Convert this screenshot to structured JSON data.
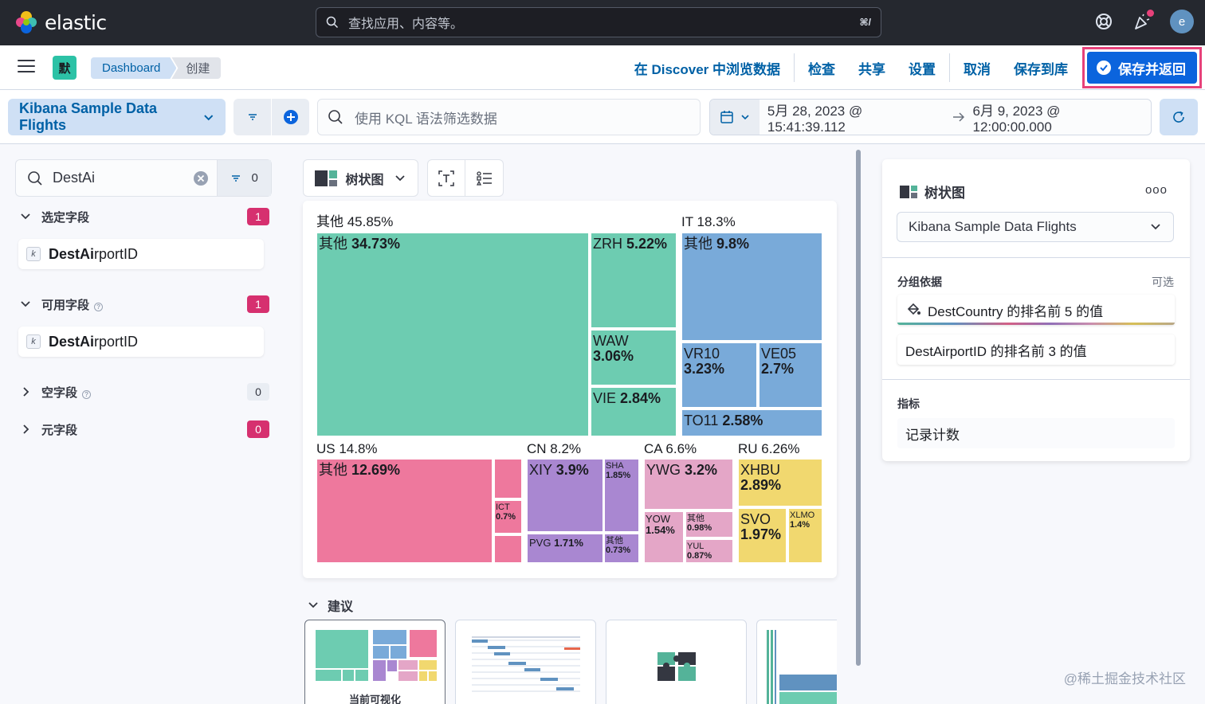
{
  "header": {
    "logo_text": "elastic",
    "search_placeholder": "查找应用、内容等。",
    "search_shortcut": "⌘/",
    "avatar_initial": "e",
    "brand_colors": [
      "#f0bf1a",
      "#e8488b",
      "#3ebeb0",
      "#0b64dd"
    ]
  },
  "subbar": {
    "space_initial": "默",
    "breadcrumbs": [
      "Dashboard",
      "创建"
    ],
    "actions": [
      "在 Discover 中浏览数据",
      "检查",
      "共享",
      "设置",
      "取消",
      "保存到库"
    ],
    "save_return": "保存并返回"
  },
  "querybar": {
    "data_view": "Kibana Sample Data Flights",
    "kql_placeholder": "使用 KQL 语法筛选数据",
    "date_start": "5月 28, 2023 @ 15:41:39.112",
    "date_end": "6月 9, 2023 @ 12:00:00.000"
  },
  "fields": {
    "search_value": "DestAi",
    "filter_count": "0",
    "selected": {
      "label": "选定字段",
      "count": "1",
      "items": [
        {
          "match": "DestAi",
          "rest": "rportID"
        }
      ]
    },
    "available": {
      "label": "可用字段",
      "count": "1",
      "items": [
        {
          "match": "DestAi",
          "rest": "rportID"
        }
      ]
    },
    "empty": {
      "label": "空字段",
      "count": "0"
    },
    "meta": {
      "label": "元字段",
      "count": "0"
    }
  },
  "workspace": {
    "chart_type_label": "树状图",
    "suggestions_label": "建议",
    "current_viz_label": "当前可视化"
  },
  "chart_data": {
    "type": "treemap",
    "groups": [
      {
        "name": "其他",
        "pct": "45.85%",
        "color": "#6dccb1",
        "children": [
          {
            "name": "其他",
            "pct": "34.73%"
          },
          {
            "name": "ZRH",
            "pct": "5.22%"
          },
          {
            "name": "WAW",
            "pct": "3.06%"
          },
          {
            "name": "VIE",
            "pct": "2.84%"
          }
        ]
      },
      {
        "name": "IT",
        "pct": "18.3%",
        "color": "#79aad9",
        "children": [
          {
            "name": "其他",
            "pct": "9.8%"
          },
          {
            "name": "VR10",
            "pct": "3.23%"
          },
          {
            "name": "VE05",
            "pct": "2.7%"
          },
          {
            "name": "TO11",
            "pct": "2.58%"
          }
        ]
      },
      {
        "name": "US",
        "pct": "14.8%",
        "color": "#ee789d",
        "children": [
          {
            "name": "其他",
            "pct": "12.69%"
          },
          {
            "name": "ICT",
            "pct": "0.7%"
          }
        ]
      },
      {
        "name": "CN",
        "pct": "8.2%",
        "color": "#a987d1",
        "children": [
          {
            "name": "XIY",
            "pct": "3.9%"
          },
          {
            "name": "SHA",
            "pct": "1.85%"
          },
          {
            "name": "PVG",
            "pct": "1.71%"
          },
          {
            "name": "其他",
            "pct": "0.73%"
          }
        ]
      },
      {
        "name": "CA",
        "pct": "6.6%",
        "color": "#e4a6c7",
        "children": [
          {
            "name": "YWG",
            "pct": "3.2%"
          },
          {
            "name": "YOW",
            "pct": "1.54%"
          },
          {
            "name": "其他",
            "pct": "0.98%"
          },
          {
            "name": "YUL",
            "pct": "0.87%"
          }
        ]
      },
      {
        "name": "RU",
        "pct": "6.26%",
        "color": "#f1d86f",
        "children": [
          {
            "name": "XHBU",
            "pct": "2.89%"
          },
          {
            "name": "SVO",
            "pct": "1.97%"
          },
          {
            "name": "XLMO",
            "pct": "1.4%"
          }
        ]
      }
    ]
  },
  "config": {
    "title": "树状图",
    "more": "ooo",
    "data_view": "Kibana Sample Data Flights",
    "group_by_label": "分组依据",
    "optional_label": "可选",
    "group_by_items": [
      "DestCountry 的排名前 5 的值",
      "DestAirportID 的排名前 3 的值"
    ],
    "metric_label": "指标",
    "metric_item": "记录计数"
  },
  "watermark": "@稀土掘金技术社区"
}
